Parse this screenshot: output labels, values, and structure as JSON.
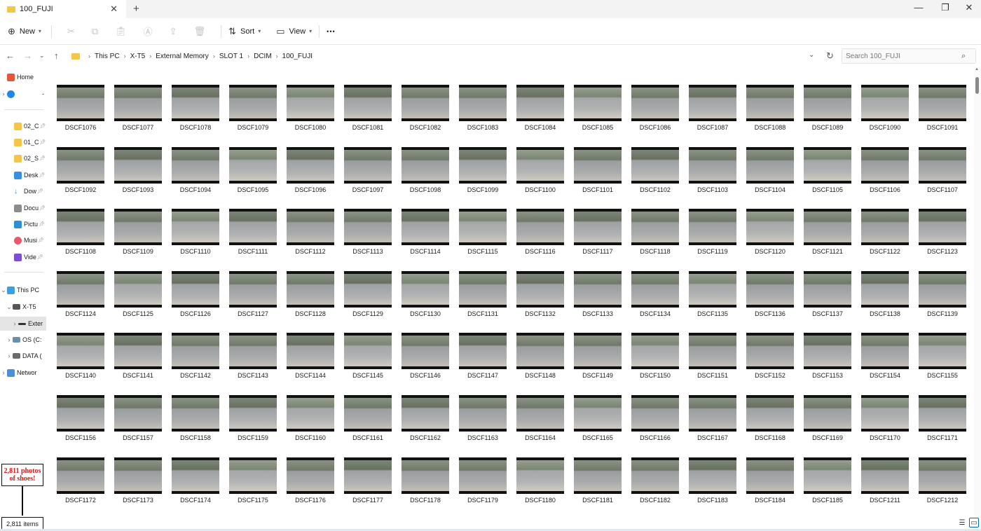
{
  "window": {
    "tab_title": "100_FUJI",
    "tab_close": "✕",
    "new_tab": "+",
    "minimize": "—",
    "restore": "❐",
    "close": "✕"
  },
  "toolbar": {
    "new_label": "New",
    "sort_label": "Sort",
    "view_label": "View",
    "more_label": "•••"
  },
  "address": {
    "crumbs": [
      "This PC",
      "X-T5",
      "External Memory",
      "SLOT 1",
      "DCIM",
      "100_FUJI"
    ],
    "search_placeholder": "Search 100_FUJI"
  },
  "sidebar": {
    "items": [
      {
        "label": "Home",
        "color": "#e8553d"
      },
      {
        "label": "-",
        "color": "#1e88e5"
      },
      {
        "label": "02_C",
        "color": "#f4c54a"
      },
      {
        "label": "01_C",
        "color": "#f4c54a"
      },
      {
        "label": "02_S",
        "color": "#f4c54a"
      },
      {
        "label": "Desk",
        "color": "#3b8fe0"
      },
      {
        "label": "Dow",
        "color": "#2f7fc9"
      },
      {
        "label": "Docu",
        "color": "#8c8c8c"
      },
      {
        "label": "Pictu",
        "color": "#2d8fd5"
      },
      {
        "label": "Musi",
        "color": "#e9586b"
      },
      {
        "label": "Vide",
        "color": "#7a4fd1"
      },
      {
        "label": "This PC",
        "color": "#3aa0e0"
      },
      {
        "label": "X-T5",
        "color": "#555555"
      },
      {
        "label": "Exter",
        "color": "#333333"
      },
      {
        "label": "OS (C:",
        "color": "#6c8ea8"
      },
      {
        "label": "DATA (",
        "color": "#6c6c6c"
      },
      {
        "label": "Networ",
        "color": "#4a90d9"
      }
    ]
  },
  "files": [
    "DSCF1076",
    "DSCF1077",
    "DSCF1078",
    "DSCF1079",
    "DSCF1080",
    "DSCF1081",
    "DSCF1082",
    "DSCF1083",
    "DSCF1084",
    "DSCF1085",
    "DSCF1086",
    "DSCF1087",
    "DSCF1088",
    "DSCF1089",
    "DSCF1090",
    "DSCF1091",
    "DSCF1092",
    "DSCF1093",
    "DSCF1094",
    "DSCF1095",
    "DSCF1096",
    "DSCF1097",
    "DSCF1098",
    "DSCF1099",
    "DSCF1100",
    "DSCF1101",
    "DSCF1102",
    "DSCF1103",
    "DSCF1104",
    "DSCF1105",
    "DSCF1106",
    "DSCF1107",
    "DSCF1108",
    "DSCF1109",
    "DSCF1110",
    "DSCF1111",
    "DSCF1112",
    "DSCF1113",
    "DSCF1114",
    "DSCF1115",
    "DSCF1116",
    "DSCF1117",
    "DSCF1118",
    "DSCF1119",
    "DSCF1120",
    "DSCF1121",
    "DSCF1122",
    "DSCF1123",
    "DSCF1124",
    "DSCF1125",
    "DSCF1126",
    "DSCF1127",
    "DSCF1128",
    "DSCF1129",
    "DSCF1130",
    "DSCF1131",
    "DSCF1132",
    "DSCF1133",
    "DSCF1134",
    "DSCF1135",
    "DSCF1136",
    "DSCF1137",
    "DSCF1138",
    "DSCF1139",
    "DSCF1140",
    "DSCF1141",
    "DSCF1142",
    "DSCF1143",
    "DSCF1144",
    "DSCF1145",
    "DSCF1146",
    "DSCF1147",
    "DSCF1148",
    "DSCF1149",
    "DSCF1150",
    "DSCF1151",
    "DSCF1152",
    "DSCF1153",
    "DSCF1154",
    "DSCF1155",
    "DSCF1156",
    "DSCF1157",
    "DSCF1158",
    "DSCF1159",
    "DSCF1160",
    "DSCF1161",
    "DSCF1162",
    "DSCF1163",
    "DSCF1164",
    "DSCF1165",
    "DSCF1166",
    "DSCF1167",
    "DSCF1168",
    "DSCF1169",
    "DSCF1170",
    "DSCF1171",
    "DSCF1172",
    "DSCF1173",
    "DSCF1174",
    "DSCF1175",
    "DSCF1176",
    "DSCF1177",
    "DSCF1178",
    "DSCF1179",
    "DSCF1180",
    "DSCF1181",
    "DSCF1182",
    "DSCF1183",
    "DSCF1184",
    "DSCF1185",
    "DSCF1211",
    "DSCF1212"
  ],
  "status": {
    "item_count": "2,811 items"
  },
  "annotation": {
    "text": "2,811 photos of shoes!",
    "color": "#d01818"
  },
  "colors": {
    "folder": "#f4c54a",
    "accent": "#0067c0"
  }
}
